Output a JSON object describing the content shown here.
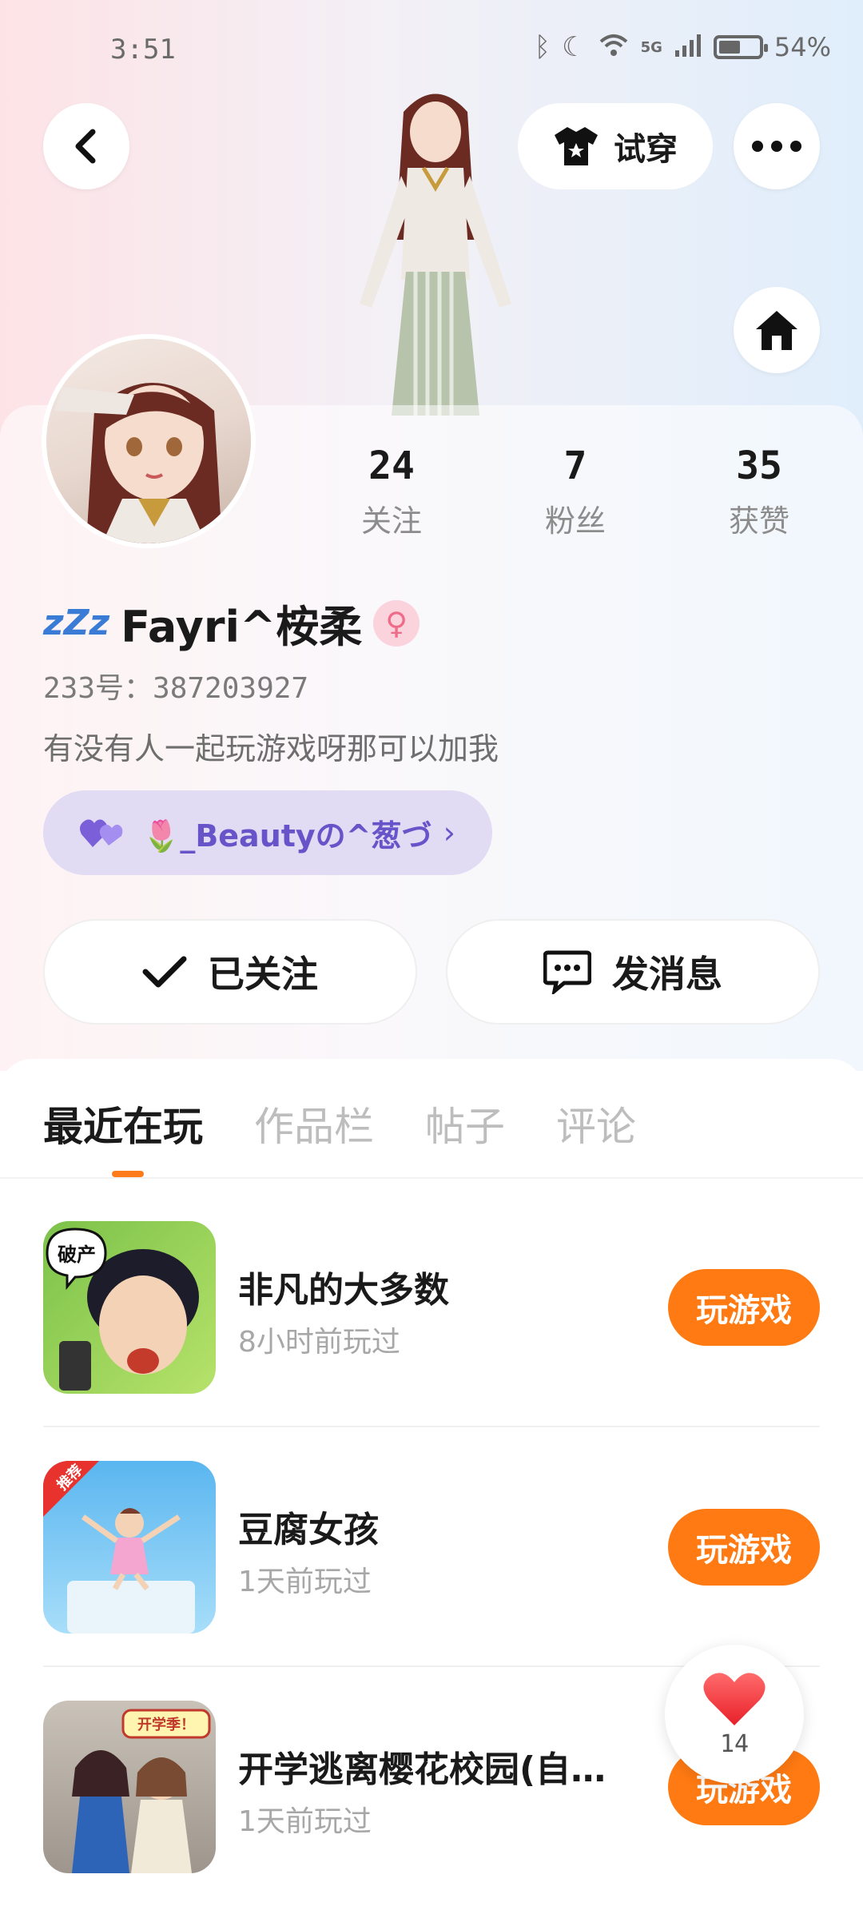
{
  "status_bar": {
    "time": "3:51",
    "network": "5G",
    "battery_text": "54%",
    "battery_level": 0.54
  },
  "header": {
    "tryon_label": "试穿"
  },
  "stats": [
    {
      "value": "24",
      "label": "关注"
    },
    {
      "value": "7",
      "label": "粉丝"
    },
    {
      "value": "35",
      "label": "获赞"
    }
  ],
  "profile": {
    "username": "Fayri^桉柔",
    "id_line": "233号：387203927",
    "bio": "有没有人一起玩游戏呀那可以加我",
    "friend_name": "🌷_Beautyの^葱づ"
  },
  "actions": {
    "follow_label": "已关注",
    "message_label": "发消息"
  },
  "tabs": [
    {
      "label": "最近在玩",
      "active": true
    },
    {
      "label": "作品栏",
      "active": false
    },
    {
      "label": "帖子",
      "active": false
    },
    {
      "label": "评论",
      "active": false
    }
  ],
  "games": [
    {
      "name": "非凡的大多数",
      "time": "8小时前玩过",
      "play_label": "玩游戏",
      "thumb_text": "破产"
    },
    {
      "name": "豆腐女孩",
      "time": "1天前玩过",
      "play_label": "玩游戏",
      "thumb_text": "推荐"
    },
    {
      "name": "开学逃离樱花校园(自…",
      "time": "1天前玩过",
      "play_label": "玩游戏",
      "thumb_text": "开学季！"
    }
  ],
  "like_float": {
    "count": "14"
  },
  "colors": {
    "accent": "#ff7a12",
    "friend_pill": "#e1dbf4",
    "friend_text": "#6754c9"
  }
}
